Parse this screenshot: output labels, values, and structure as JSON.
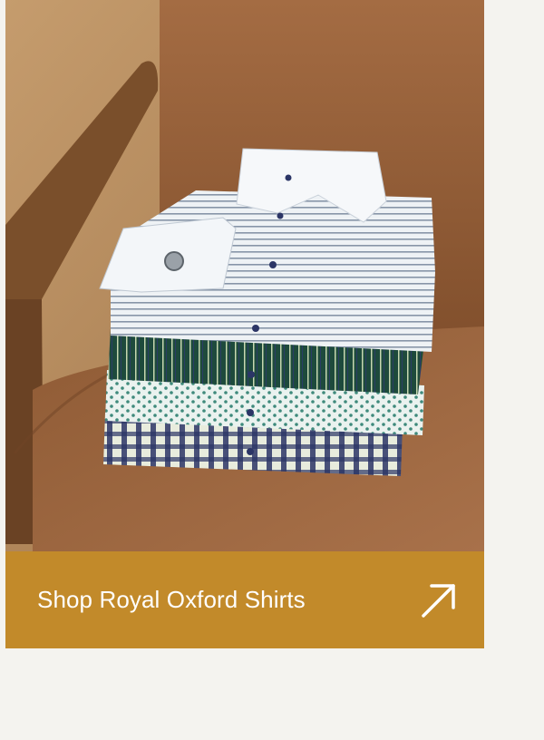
{
  "promo": {
    "image": {
      "alt": "",
      "subject": "folded-shirt-stack-on-leather-chair",
      "colors": {
        "wall": "#b48b5e",
        "leather": "#9a6640",
        "wood": "#7a4f2b",
        "band": "#c28a2a"
      }
    },
    "cta": {
      "label": "Shop Royal Oxford Shirts",
      "icon": "arrow-up-right-icon"
    }
  }
}
